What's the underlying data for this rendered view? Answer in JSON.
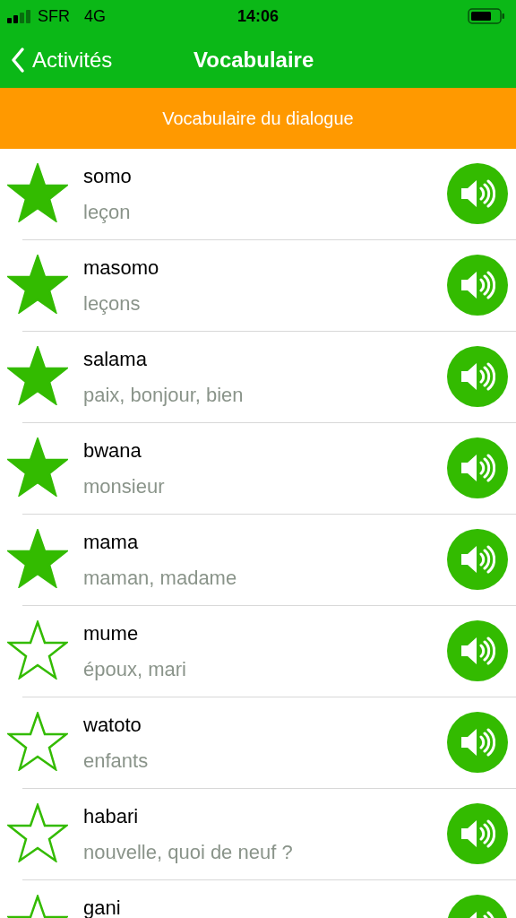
{
  "status_bar": {
    "carrier": "SFR",
    "network": "4G",
    "time": "14:06"
  },
  "nav": {
    "back_label": "Activités",
    "title": "Vocabulaire"
  },
  "section": {
    "title": "Vocabulaire du dialogue"
  },
  "words": [
    {
      "word": "somo",
      "translation": "leçon",
      "starred": true
    },
    {
      "word": "masomo",
      "translation": "leçons",
      "starred": true
    },
    {
      "word": "salama",
      "translation": "paix, bonjour, bien",
      "starred": true
    },
    {
      "word": "bwana",
      "translation": "monsieur",
      "starred": true
    },
    {
      "word": "mama",
      "translation": "maman, madame",
      "starred": true
    },
    {
      "word": "mume",
      "translation": "époux, mari",
      "starred": false
    },
    {
      "word": "watoto",
      "translation": "enfants",
      "starred": false
    },
    {
      "word": "habari",
      "translation": "nouvelle, quoi de neuf ?",
      "starred": false
    },
    {
      "word": "gani",
      "starred": false
    }
  ]
}
